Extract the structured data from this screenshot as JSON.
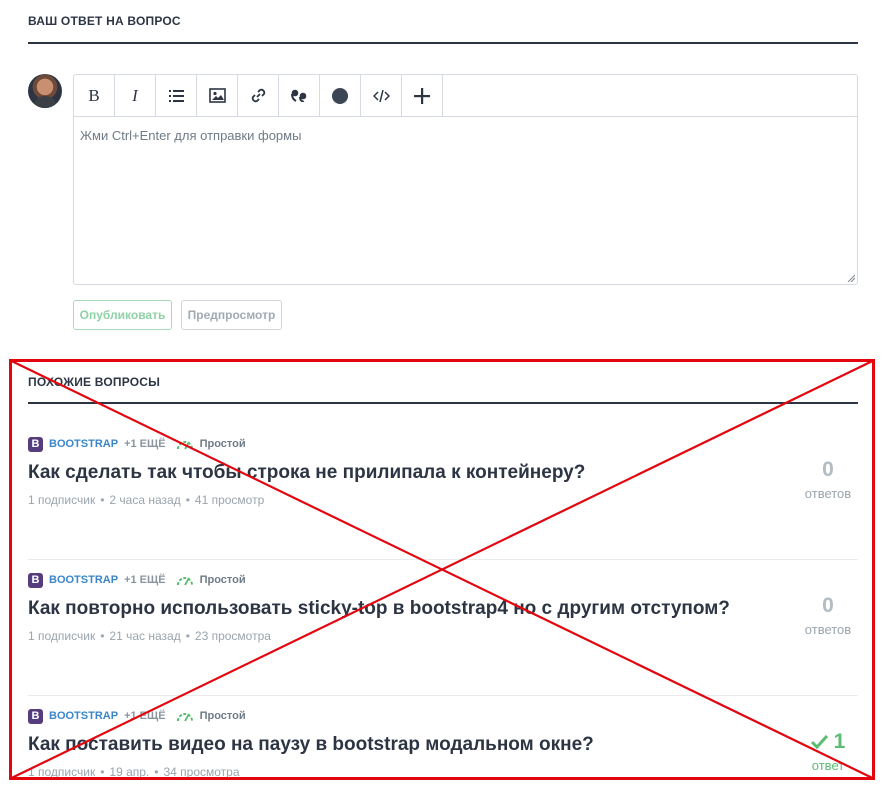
{
  "answer_form": {
    "title": "ВАШ ОТВЕТ НА ВОПРОС",
    "editor": {
      "placeholder": "Жми Ctrl+Enter для отправки формы",
      "toolbar": [
        {
          "name": "bold",
          "glyph": "B"
        },
        {
          "name": "italic",
          "glyph": "I"
        },
        {
          "name": "list",
          "glyph": "≡"
        },
        {
          "name": "image",
          "glyph": "▣"
        },
        {
          "name": "link",
          "glyph": "⚯"
        },
        {
          "name": "quote",
          "glyph": "❛❛"
        },
        {
          "name": "spoiler",
          "glyph": "●"
        },
        {
          "name": "code",
          "glyph": "</>"
        },
        {
          "name": "more",
          "glyph": "+"
        }
      ]
    },
    "publish_label": "Опубликовать",
    "preview_label": "Предпросмотр"
  },
  "similar": {
    "title": "ПОХОЖИЕ ВОПРОСЫ",
    "questions": [
      {
        "tag_logo": "B",
        "tag": "BOOTSTRAP",
        "more_tags": "+1 ЕЩЁ",
        "complexity": "Простой",
        "title": "Как сделать так чтобы строка не прилипала к контейнеру?",
        "subscribers": "1 подписчик",
        "time": "2 часа назад",
        "views": "41 просмотр",
        "answers_count": "0",
        "answers_label": "ответов",
        "solved": false
      },
      {
        "tag_logo": "B",
        "tag": "BOOTSTRAP",
        "more_tags": "+1 ЕЩЁ",
        "complexity": "Простой",
        "title": "Как повторно использовать sticky-top в bootstrap4 но с другим отступом?",
        "subscribers": "1 подписчик",
        "time": "21 час назад",
        "views": "23 просмотра",
        "answers_count": "0",
        "answers_label": "ответов",
        "solved": false
      },
      {
        "tag_logo": "B",
        "tag": "BOOTSTRAP",
        "more_tags": "+1 ЕЩЁ",
        "complexity": "Простой",
        "title": "Как поставить видео на паузу в bootstrap модальном окне?",
        "subscribers": "1 подписчик",
        "time": "19 апр.",
        "views": "34 просмотра",
        "answers_count": "1",
        "answers_label": "ответ",
        "solved": true
      }
    ]
  },
  "colors": {
    "overlay_cross": "#e3060f",
    "tag_logo_bg": "#563d7c",
    "tag_link": "#3a86c8",
    "solved_green": "#5bbd72"
  }
}
